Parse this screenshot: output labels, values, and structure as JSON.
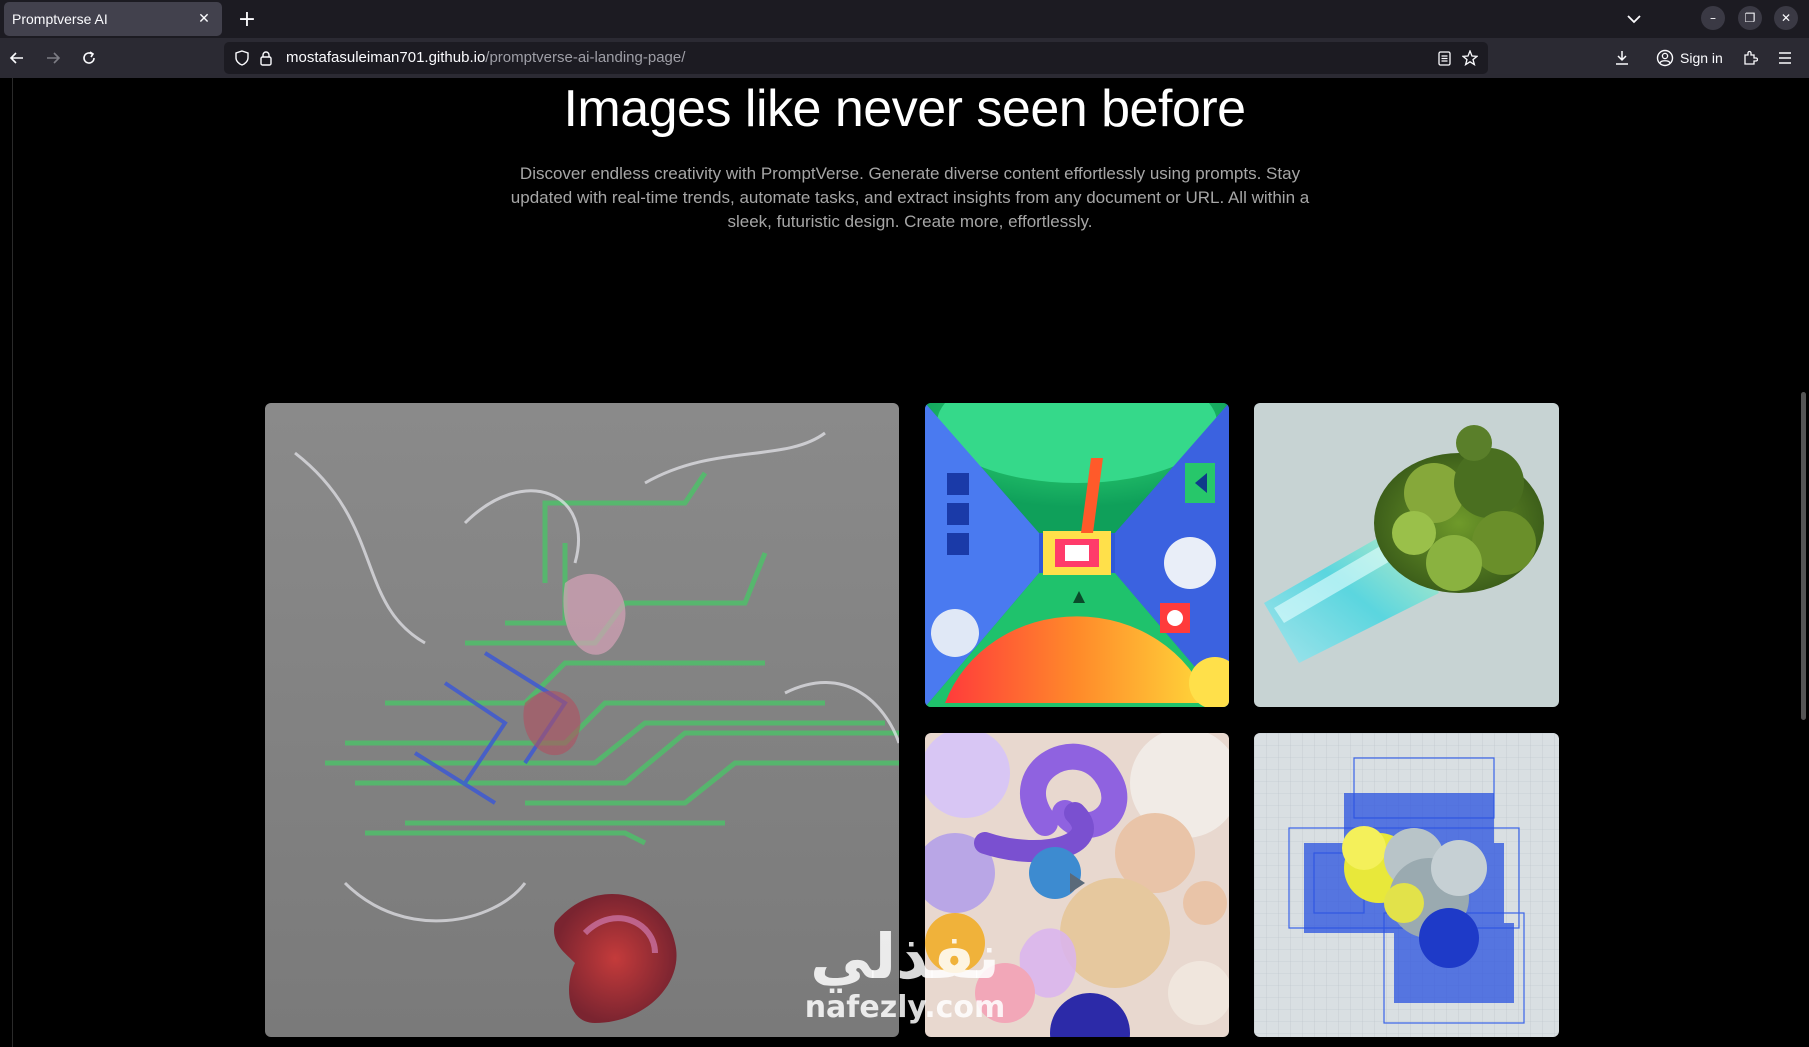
{
  "browser": {
    "tab_title": "Promptverse AI",
    "url_host": "mostafasuleiman701.github.io",
    "url_path": "/promptverse-ai-landing-page/",
    "signin_label": "Sign in"
  },
  "hero": {
    "headline": "Images like never seen before",
    "description": "Discover endless creativity with PromptVerse. Generate diverse content effortlessly using prompts. Stay updated with real-time trends, automate tasks, and extract insights from any document or URL. All within a sleek, futuristic design. Create more, effortlessly."
  },
  "watermark": {
    "arabic": "نفذلي",
    "latin": "nafezly.com"
  },
  "colors": {
    "background": "#000000",
    "headline": "#ffffff",
    "description": "#a6a6a6",
    "chrome_dark": "#1c1b22",
    "chrome_mid": "#2b2a33"
  }
}
